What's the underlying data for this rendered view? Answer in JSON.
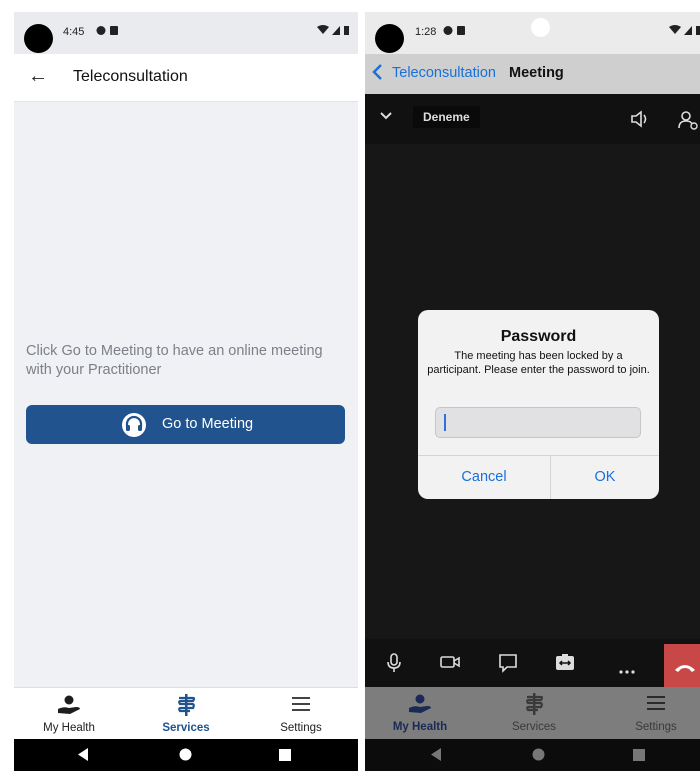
{
  "left": {
    "status": {
      "time": "4:45"
    },
    "appbar": {
      "title": "Teleconsultation"
    },
    "message": "Click Go to Meeting to have an online meeting with your Practitioner",
    "button_label": "Go to Meeting",
    "tabs": [
      {
        "label": "My Health",
        "icon": "health-hand-icon",
        "active": false
      },
      {
        "label": "Services",
        "icon": "caduceus-icon",
        "active": true
      },
      {
        "label": "Settings",
        "icon": "menu-icon",
        "active": false
      }
    ]
  },
  "right": {
    "status": {
      "time": "1:28"
    },
    "nav": {
      "back_label": "Teleconsultation",
      "title": "Meeting"
    },
    "meeting": {
      "name": "Deneme"
    },
    "dialog": {
      "title": "Password",
      "message": "The meeting has been locked by a participant. Please enter the password to join.",
      "input_value": "",
      "cancel_label": "Cancel",
      "ok_label": "OK"
    },
    "tabs": [
      {
        "label": "My Health",
        "icon": "health-hand-icon",
        "active": true
      },
      {
        "label": "Services",
        "icon": "caduceus-icon",
        "active": false
      },
      {
        "label": "Settings",
        "icon": "menu-icon",
        "active": false
      }
    ]
  },
  "colors": {
    "primary": "#21538f",
    "ios_blue": "#1a6fd9",
    "hangup_red": "#c84848",
    "left_background": "#eff1f4",
    "meeting_background": "#171717"
  }
}
